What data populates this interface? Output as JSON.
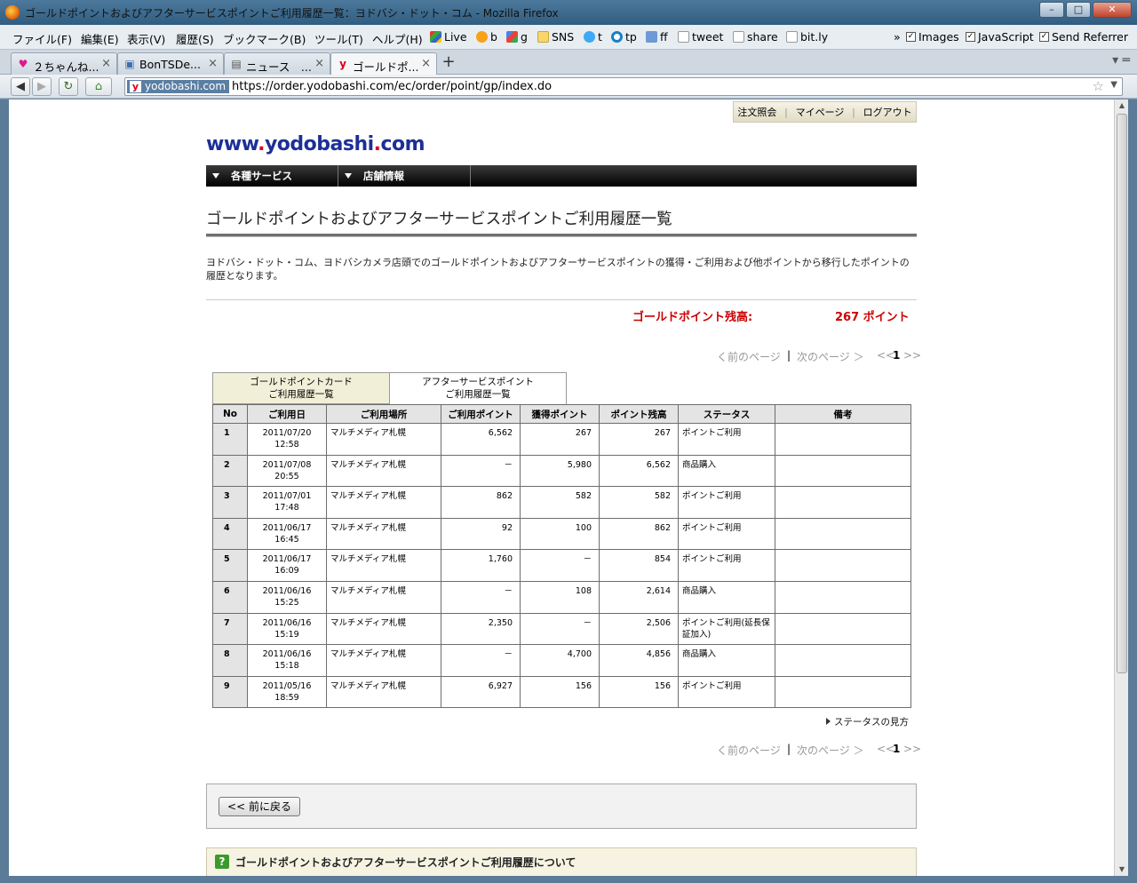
{
  "window": {
    "title": "ゴールドポイントおよびアフターサービスポイントご利用履歴一覧：ヨドバシ・ドット・コム - Mozilla Firefox",
    "minimize": "–",
    "maximize": "□",
    "close": "✕"
  },
  "menubar": {
    "items": [
      "ファイル(F)",
      "編集(E)",
      "表示(V)",
      "履歴(S)",
      "ブックマーク(B)",
      "ツール(T)",
      "ヘルプ(H)"
    ],
    "bookmarks": [
      "Live",
      "b",
      "g",
      "SNS",
      "t",
      "tp",
      "ff",
      "tweet",
      "share",
      "bit.ly"
    ],
    "overflow": "»",
    "toggles": [
      "Images",
      "JavaScript",
      "Send Referrer"
    ]
  },
  "tabs": [
    {
      "label": "２ちゃんね...",
      "icon": "♥"
    },
    {
      "label": "BonTSDe...",
      "icon": "▣"
    },
    {
      "label": "ニュース　...",
      "icon": "▤"
    },
    {
      "label": "ゴールドポ...",
      "icon": "y"
    }
  ],
  "tab_close": "×",
  "new_tab": "+",
  "navbar": {
    "back": "◀",
    "forward": "▶",
    "reload": "↻",
    "home": "⌂",
    "site_identity": "yodobashi.com",
    "url": "https://order.yodobashi.com/ec/order/point/gp/index.do",
    "star": "☆"
  },
  "page": {
    "topnav": [
      "注文照会",
      "マイページ",
      "ログアウト"
    ],
    "logo_pre": "www",
    "logo_dot": ".",
    "logo_mid": "yodobashi",
    "logo_dot2": ".",
    "logo_post": "com",
    "menu": [
      "各種サービス",
      "店舗情報"
    ],
    "title": "ゴールドポイントおよびアフターサービスポイントご利用履歴一覧",
    "description": "ヨドバシ・ドット・コム、ヨドバシカメラ店頭でのゴールドポイントおよびアフターサービスポイントの獲得・ご利用および他ポイントから移行したポイントの履歴となります。",
    "balance_label": "ゴールドポイント残高:",
    "balance_value": "267  ポイント",
    "pager": {
      "prev": "く前のページ",
      "next": "次のページ ＞",
      "first": "<<",
      "current": "1",
      "last": ">>"
    },
    "subtabs": [
      {
        "line1": "ゴールドポイントカード",
        "line2": "ご利用履歴一覧"
      },
      {
        "line1": "アフターサービスポイント",
        "line2": "ご利用履歴一覧"
      }
    ],
    "table": {
      "headers": [
        "No",
        "ご利用日",
        "ご利用場所",
        "ご利用ポイント",
        "獲得ポイント",
        "ポイント残高",
        "ステータス",
        "備考"
      ],
      "rows": [
        {
          "no": "1",
          "date": "2011/07/20",
          "time": "12:58",
          "place": "マルチメディア札幌",
          "used": "6,562",
          "earned": "267",
          "balance": "267",
          "status": "ポイントご利用",
          "note": ""
        },
        {
          "no": "2",
          "date": "2011/07/08",
          "time": "20:55",
          "place": "マルチメディア札幌",
          "used": "－",
          "earned": "5,980",
          "balance": "6,562",
          "status": "商品購入",
          "note": ""
        },
        {
          "no": "3",
          "date": "2011/07/01",
          "time": "17:48",
          "place": "マルチメディア札幌",
          "used": "862",
          "earned": "582",
          "balance": "582",
          "status": "ポイントご利用",
          "note": ""
        },
        {
          "no": "4",
          "date": "2011/06/17",
          "time": "16:45",
          "place": "マルチメディア札幌",
          "used": "92",
          "earned": "100",
          "balance": "862",
          "status": "ポイントご利用",
          "note": ""
        },
        {
          "no": "5",
          "date": "2011/06/17",
          "time": "16:09",
          "place": "マルチメディア札幌",
          "used": "1,760",
          "earned": "－",
          "balance": "854",
          "status": "ポイントご利用",
          "note": ""
        },
        {
          "no": "6",
          "date": "2011/06/16",
          "time": "15:25",
          "place": "マルチメディア札幌",
          "used": "－",
          "earned": "108",
          "balance": "2,614",
          "status": "商品購入",
          "note": ""
        },
        {
          "no": "7",
          "date": "2011/06/16",
          "time": "15:19",
          "place": "マルチメディア札幌",
          "used": "2,350",
          "earned": "－",
          "balance": "2,506",
          "status": "ポイントご利用(延長保証加入)",
          "note": ""
        },
        {
          "no": "8",
          "date": "2011/06/16",
          "time": "15:18",
          "place": "マルチメディア札幌",
          "used": "－",
          "earned": "4,700",
          "balance": "4,856",
          "status": "商品購入",
          "note": ""
        },
        {
          "no": "9",
          "date": "2011/05/16",
          "time": "18:59",
          "place": "マルチメディア札幌",
          "used": "6,927",
          "earned": "156",
          "balance": "156",
          "status": "ポイントご利用",
          "note": ""
        }
      ]
    },
    "status_help": "ステータスの見方",
    "back_button": "<< 前に戻る",
    "about": "ゴールドポイントおよびアフターサービスポイントご利用履歴について",
    "about_icon": "?"
  }
}
